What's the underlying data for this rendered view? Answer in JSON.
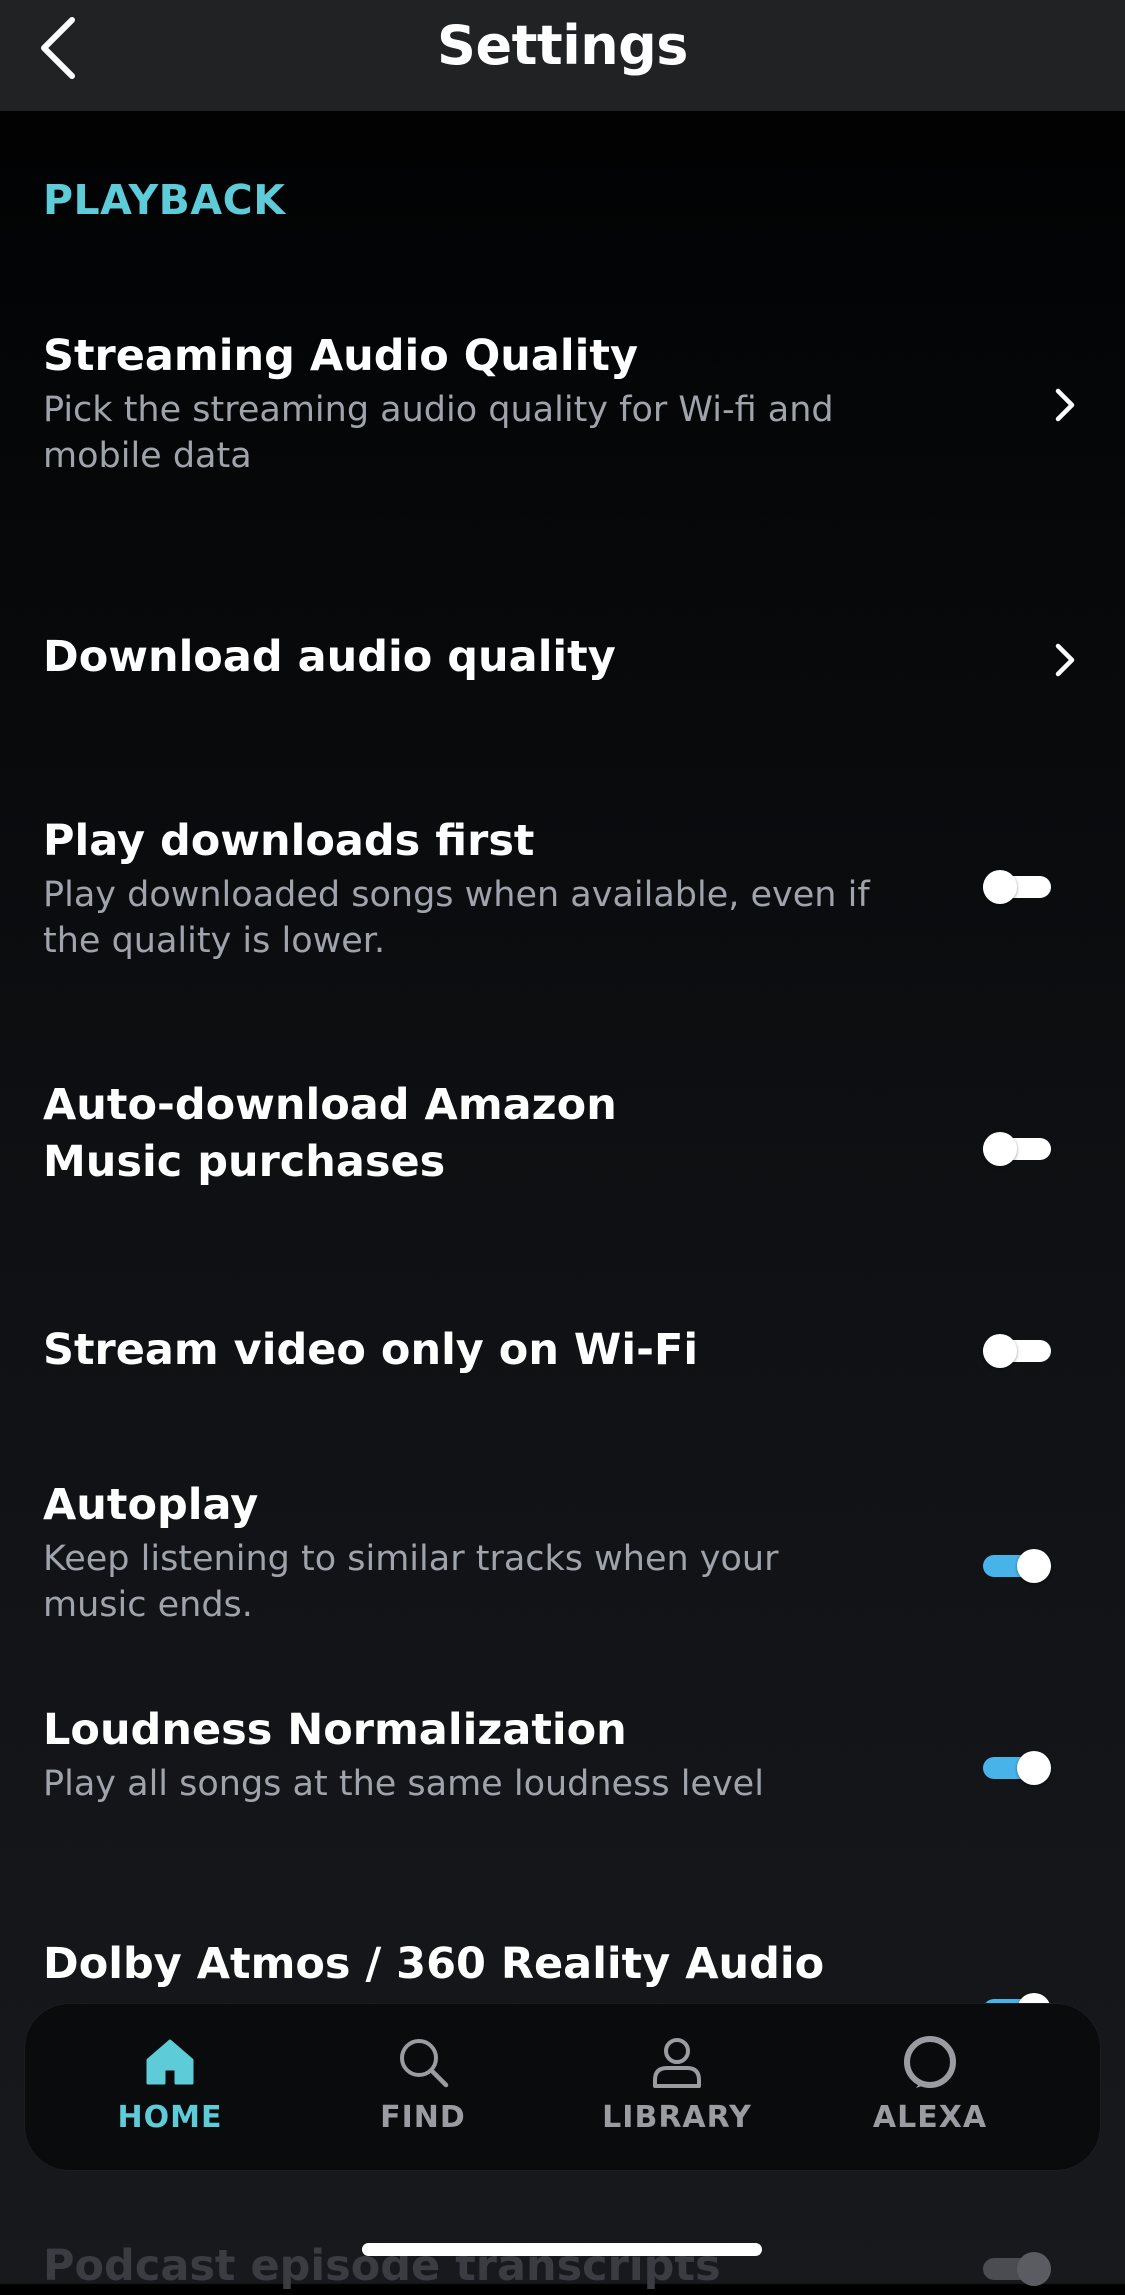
{
  "header": {
    "title": "Settings",
    "back_icon": "chevron-left-icon"
  },
  "section": {
    "title": "PLAYBACK"
  },
  "rows": [
    {
      "title": "Streaming Audio Quality",
      "subtitle": "Pick the streaming audio quality for Wi-fi and\nmobile data",
      "control": "chevron"
    },
    {
      "title": "Download audio quality",
      "subtitle": "",
      "control": "chevron"
    },
    {
      "title": "Play downloads first",
      "subtitle": "Play downloaded songs when available, even if\nthe quality is lower.",
      "control": "toggle",
      "on": false
    },
    {
      "title": "Auto-download Amazon\nMusic purchases",
      "subtitle": "",
      "control": "toggle",
      "on": false
    },
    {
      "title": "Stream video only on Wi-Fi",
      "subtitle": "",
      "control": "toggle",
      "on": false
    },
    {
      "title": "Autoplay",
      "subtitle": "Keep listening to similar tracks when your\nmusic ends.",
      "control": "toggle",
      "on": true
    },
    {
      "title": "Loudness Normalization",
      "subtitle": "Play all songs at the same loudness level",
      "control": "toggle",
      "on": true
    },
    {
      "title": "Dolby Atmos / 360 Reality Audio",
      "subtitle": "",
      "control": "toggle",
      "on": true
    }
  ],
  "partial_row": {
    "title": "Podcast episode transcripts"
  },
  "nav": {
    "items": [
      {
        "label": "HOME",
        "icon": "home-icon",
        "active": true
      },
      {
        "label": "FIND",
        "icon": "search-icon",
        "active": false
      },
      {
        "label": "LIBRARY",
        "icon": "person-icon",
        "active": false
      },
      {
        "label": "ALEXA",
        "icon": "alexa-ring-icon",
        "active": false
      }
    ]
  },
  "colors": {
    "accent": "#5ecbd9",
    "toggle_on": "#48b3e9",
    "subtitle": "#9fa3ab",
    "topbar": "#212224"
  }
}
